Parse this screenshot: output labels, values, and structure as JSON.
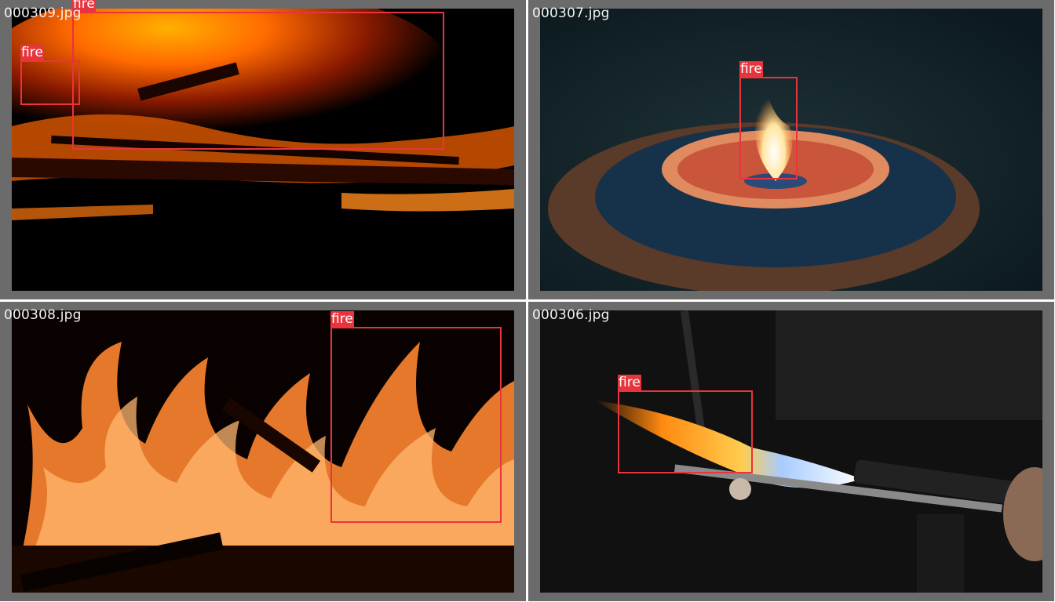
{
  "panels": [
    {
      "filename": "000309.jpg",
      "detections": [
        {
          "label": "fire"
        },
        {
          "label": "fire"
        }
      ]
    },
    {
      "filename": "000307.jpg",
      "detections": [
        {
          "label": "fire"
        }
      ]
    },
    {
      "filename": "000308.jpg",
      "detections": [
        {
          "label": "fire"
        }
      ]
    },
    {
      "filename": "000306.jpg",
      "detections": [
        {
          "label": "fire"
        }
      ]
    }
  ],
  "colors": {
    "box": "#e8343c",
    "panel_bg": "#6b6b6b",
    "divider": "#ffffff"
  }
}
